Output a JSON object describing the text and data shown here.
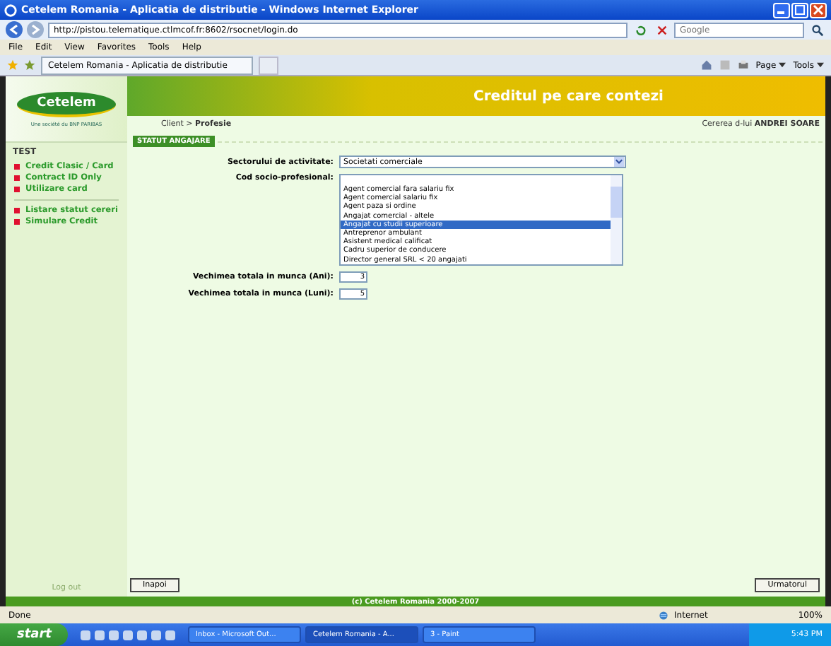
{
  "window": {
    "title": "Cetelem Romania - Aplicatia de distributie - Windows Internet Explorer"
  },
  "address_bar": {
    "url": "http://pistou.telematique.ctlmcof.fr:8602/rsocnet/login.do",
    "search_placeholder": "Google"
  },
  "menu": [
    "File",
    "Edit",
    "View",
    "Favorites",
    "Tools",
    "Help"
  ],
  "tab": {
    "title": "Cetelem Romania - Aplicatia de distributie"
  },
  "toolbar": [
    "Page",
    "Tools"
  ],
  "header": {
    "logo": "Cetelem",
    "logo_tagline": "Une société du BNP PARIBAS",
    "slogan": "Creditul pe care contezi",
    "breadcrumb": "Client > **Profesie**",
    "user": "Cererea d-lui **ANDREI SOARE**"
  },
  "sidebar": {
    "title": "TEST",
    "groups": [
      [
        "Credit Clasic / Card",
        "Contract ID Only",
        "Utilizare card"
      ],
      [
        "Listare statut cereri",
        "Simulare Credit"
      ]
    ],
    "logout": "Log out"
  },
  "form": {
    "section": "STATUT ANGAJARE",
    "sector": {
      "label": "Sectorului de activitate:",
      "value": "Societati comerciale"
    },
    "cod": {
      "label": "Cod socio-profesional:",
      "options": [
        {
          "text": "Agent comercial fara salariu fix",
          "selected": false
        },
        {
          "text": "Agent comercial salariu fix",
          "selected": false
        },
        {
          "text": "Agent paza si ordine",
          "selected": false
        },
        {
          "text": "Angajat comercial - altele",
          "selected": false
        },
        {
          "text": "Angajat cu studii superioare",
          "selected": true
        },
        {
          "text": "Antreprenor ambulant",
          "selected": false
        },
        {
          "text": "Asistent medical calificat",
          "selected": false
        },
        {
          "text": "Cadru superior de conducere",
          "selected": false
        },
        {
          "text": "Director general SRL < 20 angajati",
          "selected": false
        }
      ]
    },
    "years": {
      "label": "Vechimea totala in munca (Ani):",
      "value": "3"
    },
    "months": {
      "label": "Vechimea totala in munca (Luni):",
      "value": "5"
    }
  },
  "buttons": {
    "back": "Inapoi",
    "next": "Urmatorul"
  },
  "copyright": "(c) Cetelem Romania 2000-2007",
  "status_bar": {
    "text": "Done",
    "zone": "Internet",
    "zoom": "100%"
  },
  "taskbar": {
    "start": "start",
    "tasks": [
      {
        "title": "Inbox - Microsoft Out...",
        "selected": false
      },
      {
        "title": "Cetelem Romania - A...",
        "selected": true
      },
      {
        "title": "3 - Paint",
        "selected": false
      }
    ],
    "clock": "5:43 PM"
  }
}
